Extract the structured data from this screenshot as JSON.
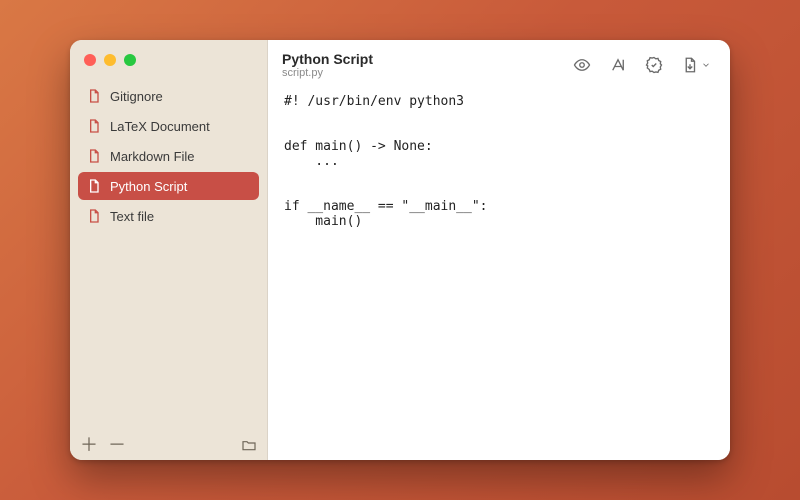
{
  "sidebar": {
    "items": [
      {
        "label": "Gitignore",
        "selected": false
      },
      {
        "label": "LaTeX Document",
        "selected": false
      },
      {
        "label": "Markdown File",
        "selected": false
      },
      {
        "label": "Python Script",
        "selected": true
      },
      {
        "label": "Text file",
        "selected": false
      }
    ]
  },
  "header": {
    "title": "Python Script",
    "subtitle": "script.py"
  },
  "toolbar_icons": {
    "preview": "eye-icon",
    "rename": "text-cursor-icon",
    "verify": "badge-check-icon",
    "export": "document-export-icon"
  },
  "editor": {
    "content": "#! /usr/bin/env python3\n\n\ndef main() -> None:\n    ...\n\n\nif __name__ == \"__main__\":\n    main()"
  },
  "colors": {
    "accent": "#c84f46",
    "sidebar_bg": "#ece4d7"
  }
}
